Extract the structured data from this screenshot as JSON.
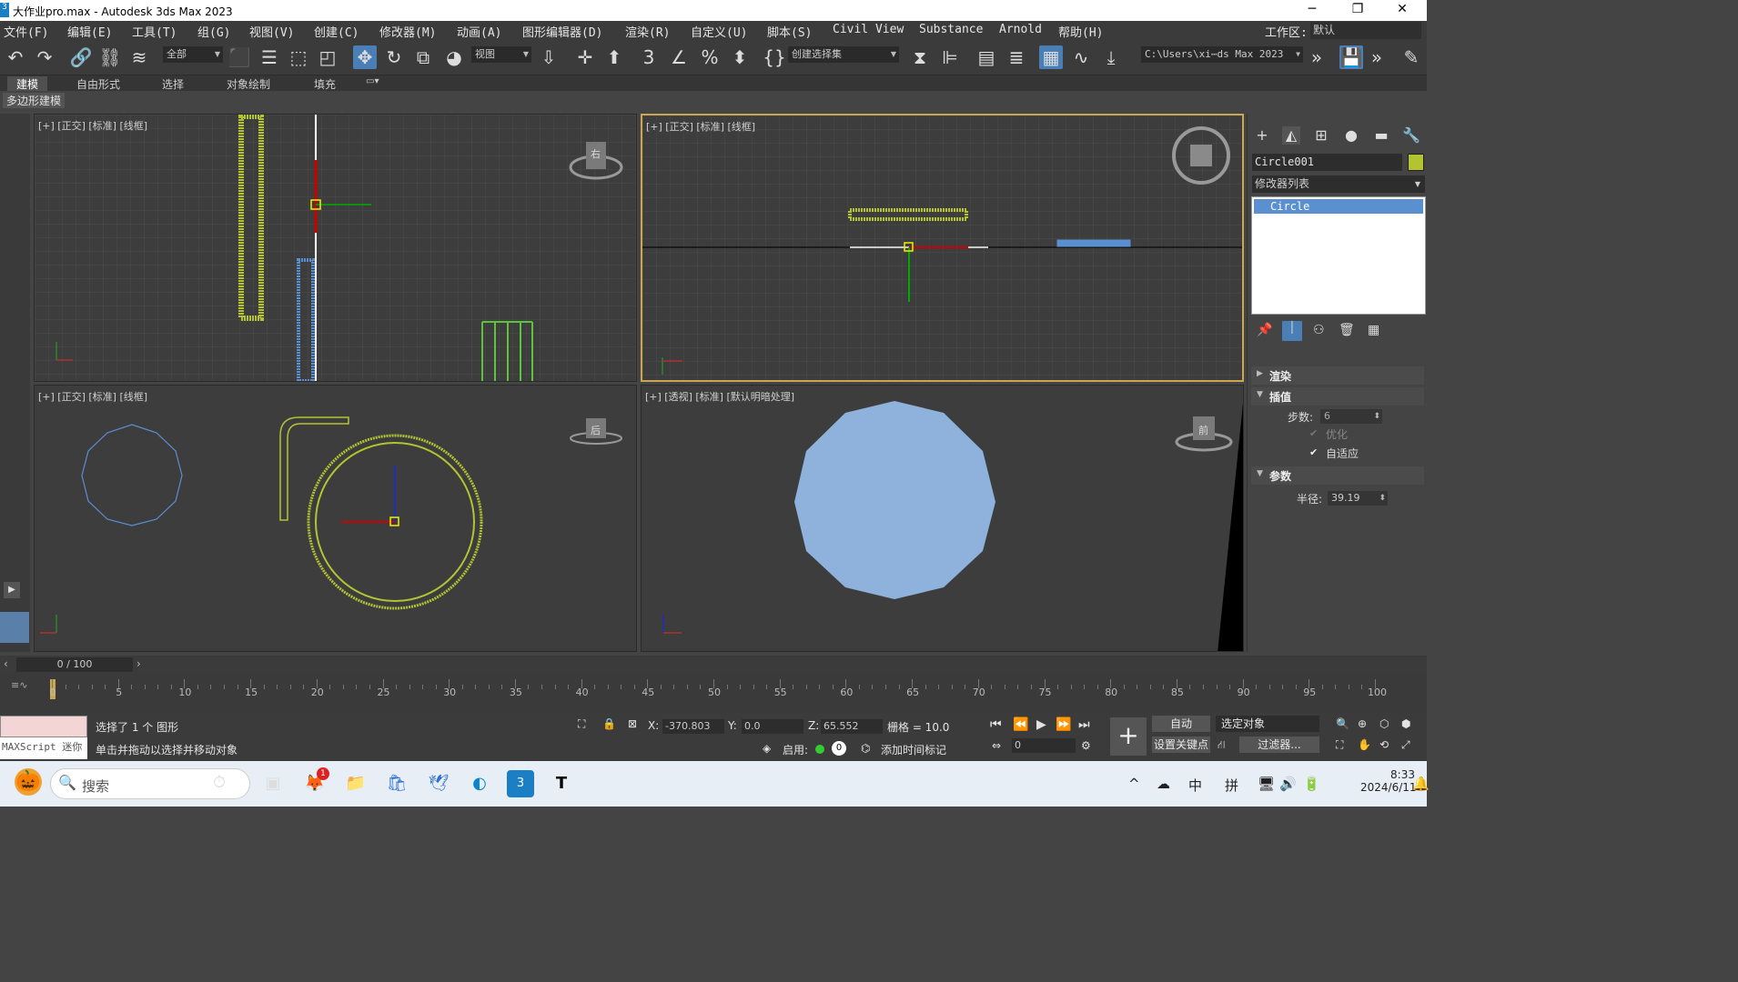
{
  "titlebar": {
    "title": "大作业pro.max - Autodesk 3ds Max 2023",
    "logo_text": "3",
    "minimize": "─",
    "maximize": "❐",
    "close": "✕"
  },
  "menu": {
    "items": [
      "文件(F)",
      "编辑(E)",
      "工具(T)",
      "组(G)",
      "视图(V)",
      "创建(C)",
      "修改器(M)",
      "动画(A)",
      "图形编辑器(D)",
      "渲染(R)",
      "自定义(U)",
      "脚本(S)",
      "Civil View",
      "Substance",
      "Arnold",
      "帮助(H)"
    ],
    "workspace_label": "工作区:",
    "workspace_value": "默认"
  },
  "toolbar": {
    "filter_dropdown": "全部",
    "refcoord_dropdown": "视图",
    "selset_dropdown": "创建选择集",
    "project_path": "C:\\Users\\xi⋯ds Max 2023"
  },
  "ribbon": {
    "tabs": [
      "建模",
      "自由形式",
      "选择",
      "对象绘制",
      "填充"
    ],
    "subtab": "多边形建模"
  },
  "viewports": {
    "top_left_label": "[+] [正交] [标准] [线框]",
    "top_right_label": "[+] [正交] [标准] [线框]",
    "bottom_left_label": "[+] [正交] [标准] [线框]",
    "bottom_right_label": "[+] [透视] [标准] [默认明暗处理]",
    "cube_top_left": "右",
    "cube_bottom_left": "后",
    "cube_bottom_right": "前"
  },
  "cmdpanel": {
    "object_name": "Circle001",
    "object_color": "#b4c430",
    "modifier_list": "修改器列表",
    "stack_item": "Circle",
    "rollouts": {
      "render": "渲染",
      "interp": "插值",
      "params": "参数"
    },
    "steps_label": "步数:",
    "steps_value": "6",
    "optimize_label": "优化",
    "adaptive_label": "自适应",
    "radius_label": "半径:",
    "radius_value": "39.19"
  },
  "frames": {
    "counter": "0 / 100",
    "ticks": [
      "0",
      "5",
      "10",
      "15",
      "20",
      "25",
      "30",
      "35",
      "40",
      "45",
      "50",
      "55",
      "60",
      "65",
      "70",
      "75",
      "80",
      "85",
      "90",
      "95",
      "100"
    ]
  },
  "status": {
    "maxscript": "MAXScript 迷你",
    "selected": "选择了 1 个 图形",
    "hint": "单击并拖动以选择并移动对象",
    "x_label": "X:",
    "x_value": "-370.803",
    "y_label": "Y:",
    "y_value": "0.0",
    "z_label": "Z:",
    "z_value": "65.552",
    "grid": "栅格 = 10.0",
    "enable_label": "启用:",
    "enable_value": "0",
    "add_time_tag": "添加时间标记",
    "auto": "自动",
    "selected_obj": "选定对象",
    "set_key": "设置关键点",
    "filters": "过滤器...",
    "frame_value": "0"
  },
  "taskbar": {
    "search_placeholder": "搜索",
    "badge": "1",
    "tray_items": [
      "^",
      "☁",
      "中",
      "拼",
      "🖥",
      "🔊",
      "🔋"
    ],
    "time": "8:33",
    "date": "2024/6/11"
  }
}
